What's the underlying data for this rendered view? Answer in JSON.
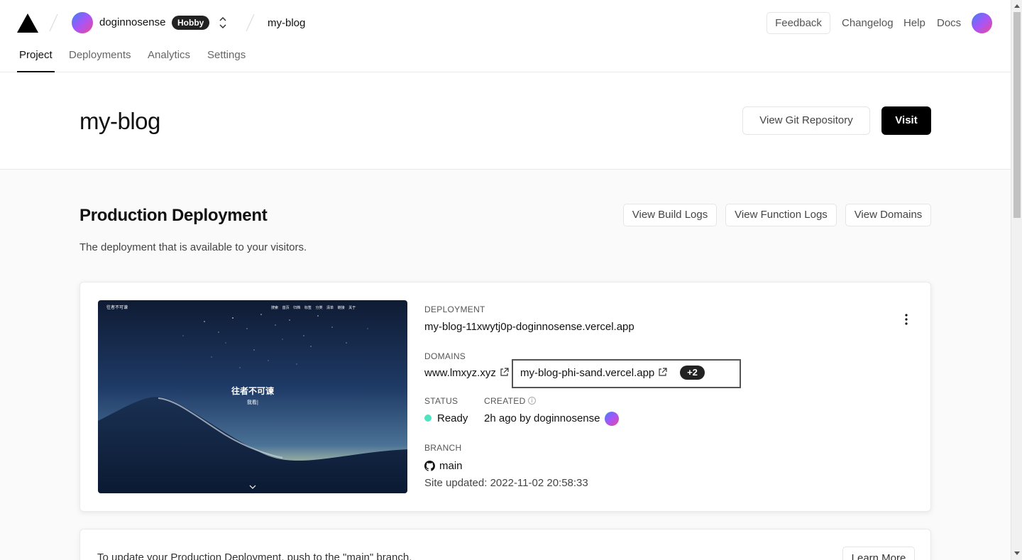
{
  "header": {
    "team_name": "doginnosense",
    "plan_badge": "Hobby",
    "project_name": "my-blog",
    "feedback_label": "Feedback",
    "links": [
      "Changelog",
      "Help",
      "Docs"
    ]
  },
  "tabs": [
    {
      "label": "Project",
      "active": true
    },
    {
      "label": "Deployments",
      "active": false
    },
    {
      "label": "Analytics",
      "active": false
    },
    {
      "label": "Settings",
      "active": false
    }
  ],
  "hero": {
    "title": "my-blog",
    "view_git_label": "View Git Repository",
    "visit_label": "Visit"
  },
  "production": {
    "title": "Production Deployment",
    "subtitle": "The deployment that is available to your visitors.",
    "buttons": [
      "View Build Logs",
      "View Function Logs",
      "View Domains"
    ]
  },
  "deployment": {
    "preview": {
      "site_title": "往者不可谏",
      "site_subtitle": "我看|",
      "nav_brand": "往者不可谏",
      "nav_items": [
        "搜索",
        "首页",
        "归档",
        "标签",
        "分类",
        "清单",
        "链接",
        "关于"
      ]
    },
    "deployment_label": "DEPLOYMENT",
    "deployment_url": "my-blog-11xwytj0p-doginnosense.vercel.app",
    "domains_label": "DOMAINS",
    "domain_primary": "www.lmxyz.xyz",
    "domain_secondary": "my-blog-phi-sand.vercel.app",
    "domains_more": "+2",
    "status_label": "STATUS",
    "status_value": "Ready",
    "status_color": "#50e3c2",
    "created_label": "CREATED",
    "created_value": "2h ago by doginnosense",
    "branch_label": "BRANCH",
    "branch_value": "main",
    "site_updated": "Site updated: 2022-11-02 20:58:33"
  },
  "update_card": {
    "text": "To update your Production Deployment, push to the \"main\" branch.",
    "learn_more": "Learn More"
  }
}
